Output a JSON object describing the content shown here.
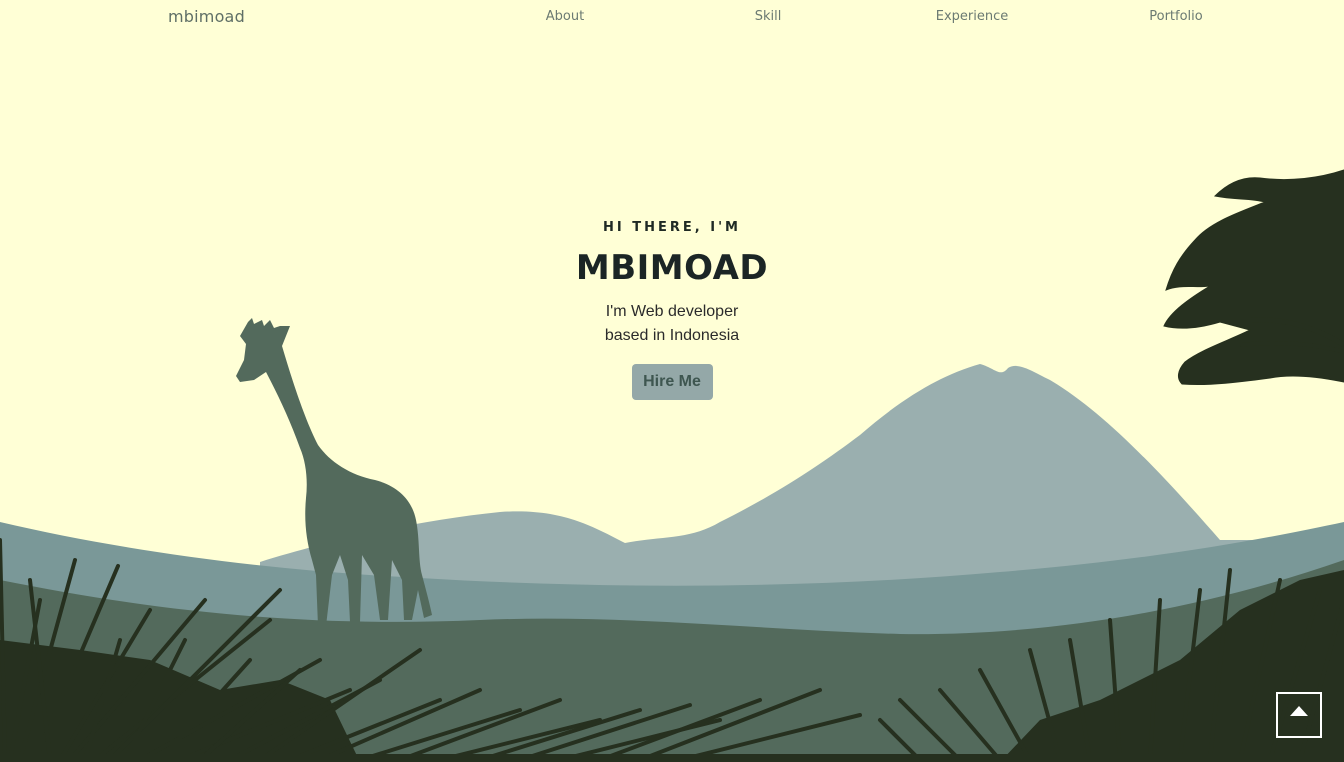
{
  "nav": {
    "brand": "mbimoad",
    "links": [
      {
        "label": "About"
      },
      {
        "label": "Skill"
      },
      {
        "label": "Experience"
      },
      {
        "label": "Portfolio"
      }
    ]
  },
  "hero": {
    "greeting": "HI THERE, I'M",
    "name": "MBIMOAD",
    "tagline_line1": "I'm Web developer",
    "tagline_line2": "based in Indonesia",
    "cta_label": "Hire Me"
  },
  "scene": {
    "sky_color": "#ffffd6",
    "mountain_color": "#9aafaf",
    "hill_color": "#7a9898",
    "ground_color": "#536a5c",
    "grass_color": "#26301f",
    "giraffe_color": "#536a5c",
    "tree_color": "#26301f",
    "icons": [
      "giraffe-icon",
      "acacia-tree-icon",
      "arrow-up-icon"
    ]
  }
}
